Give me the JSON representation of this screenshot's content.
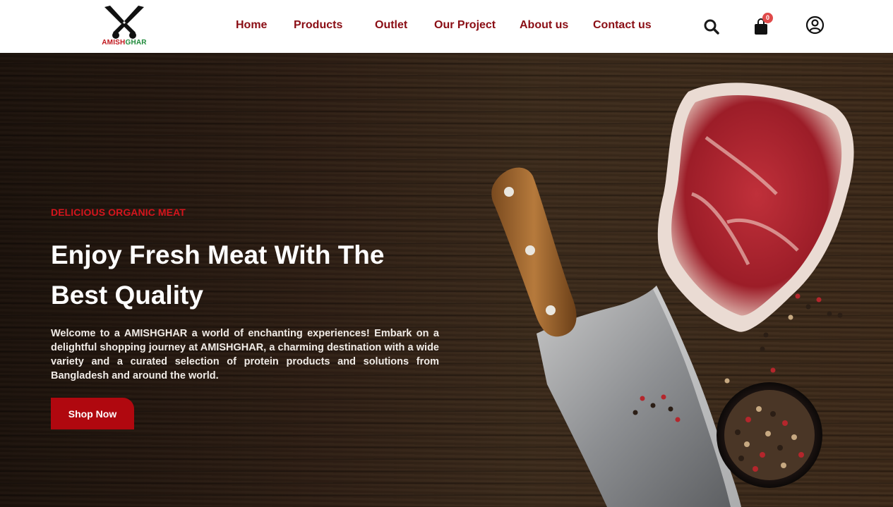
{
  "brand": {
    "logo_text_part1": "AMISH",
    "logo_text_part2": "GHAR",
    "logo_icon": "crossed-knives-icon",
    "colors": {
      "red": "#c0161c",
      "green": "#1f8a3a"
    }
  },
  "nav": {
    "items": [
      {
        "label": "Home"
      },
      {
        "label": "Products"
      },
      {
        "label": "Outlet"
      },
      {
        "label": "Our Project"
      },
      {
        "label": "About us"
      },
      {
        "label": "Contact us"
      }
    ],
    "color": "#8a0d14"
  },
  "header_icons": {
    "search": "search-icon",
    "cart": "cart-icon",
    "cart_count": "0",
    "account": "user-circle-icon"
  },
  "hero": {
    "eyebrow": "DELICIOUS ORGANIC MEAT",
    "headline": "Enjoy Fresh Meat With The Best Quality",
    "description": "Welcome to a AMISHGHAR a world of enchanting experiences! Embark on a delightful shopping journey at AMISHGHAR, a charming destination with a wide variety and a curated selection of protein products and solutions from Bangladesh and around the world.",
    "cta_label": "Shop Now",
    "accent_color": "#b0080f"
  }
}
